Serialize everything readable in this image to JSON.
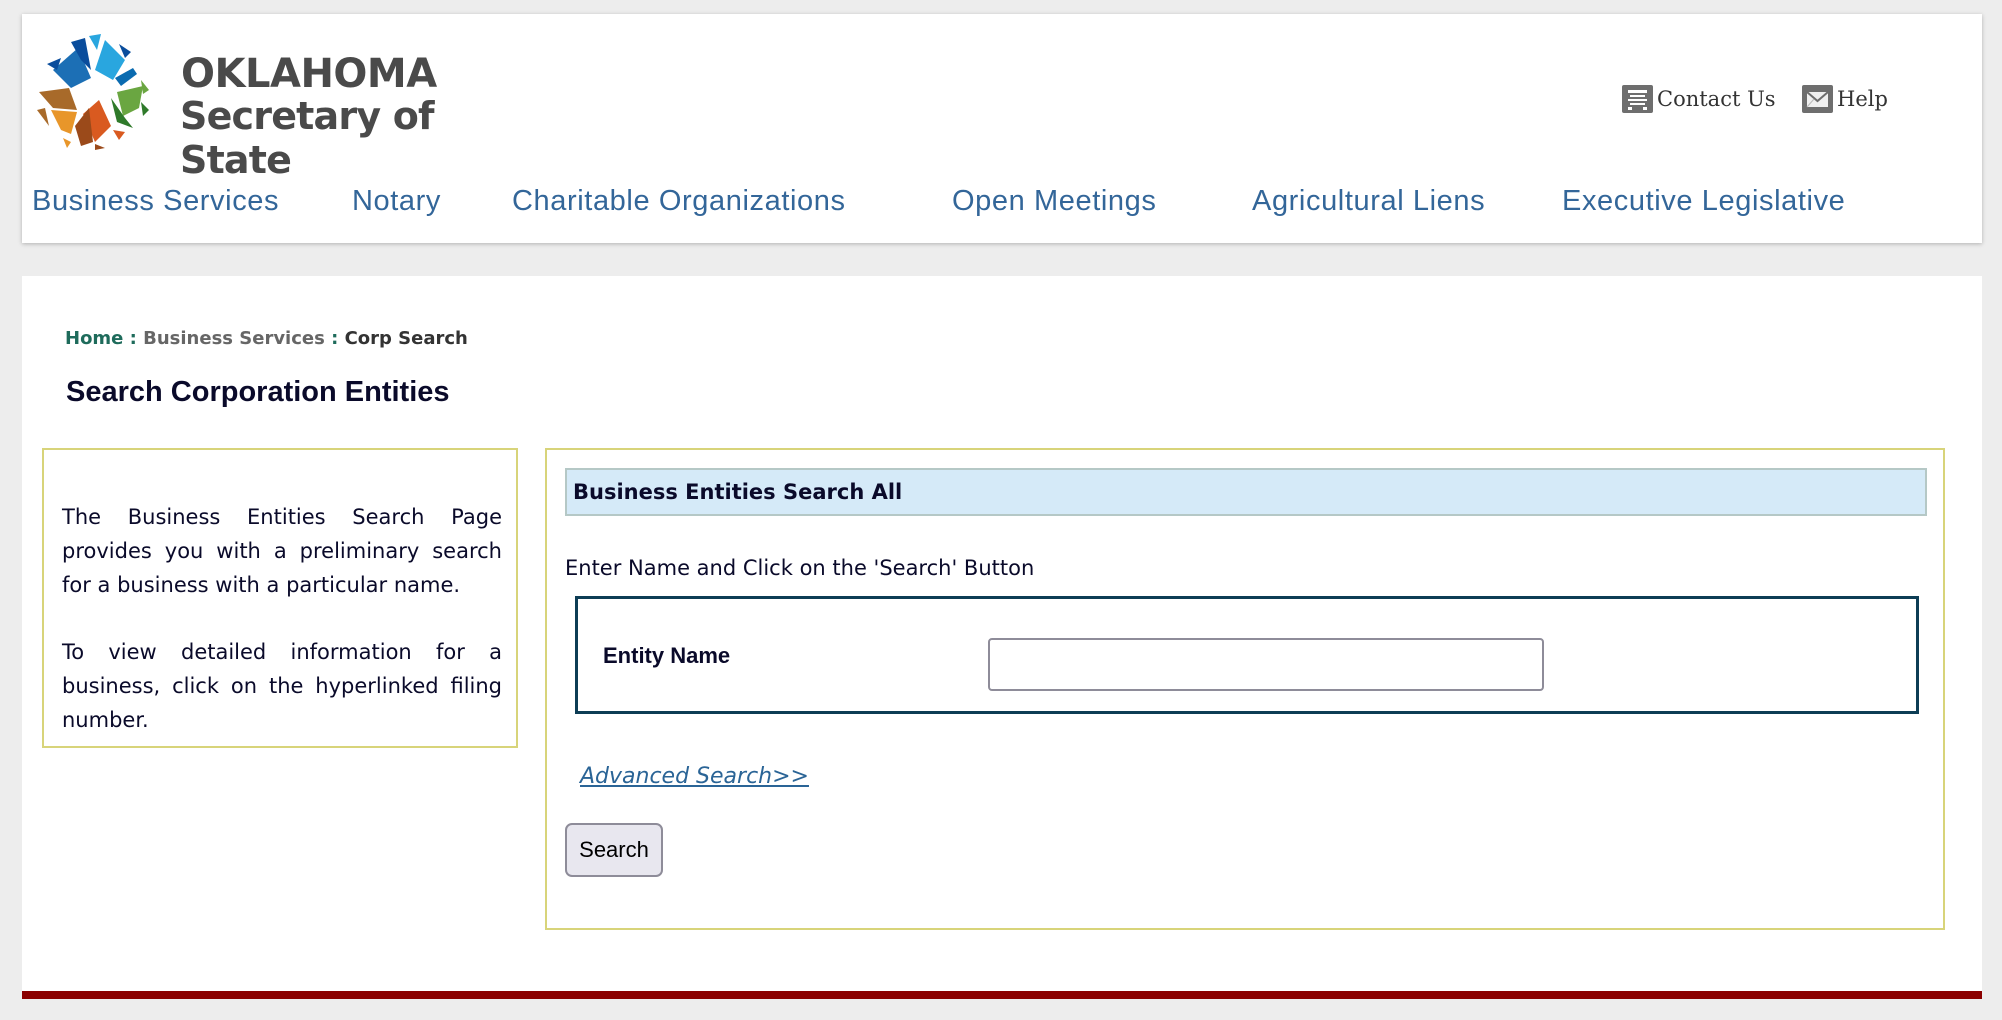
{
  "header": {
    "logo": {
      "line1": "OKLAHOMA",
      "line2": "Secretary of State",
      "icon": "oklahoma-star-logo",
      "colors": [
        "#1c6fb5",
        "#29a6df",
        "#0a4d9c",
        "#6aa641",
        "#2f7a2a",
        "#d95a20",
        "#9b4a1a",
        "#e8962a",
        "#a86a2a"
      ]
    },
    "utility_links": [
      {
        "label": "Contact Us",
        "icon": "contact-form-icon"
      },
      {
        "label": "Help",
        "icon": "envelope-icon"
      }
    ],
    "nav": [
      {
        "label": "Business Services"
      },
      {
        "label": "Notary"
      },
      {
        "label": "Charitable Organizations"
      },
      {
        "label": "Open Meetings"
      },
      {
        "label": "Agricultural Liens"
      },
      {
        "label": "Executive Legislative"
      }
    ]
  },
  "breadcrumb": {
    "home": "Home",
    "separator": " : ",
    "section": "Business Services",
    "current": "Corp Search"
  },
  "page_title": "Search Corporation Entities",
  "info": {
    "paragraph1": "The Business Entities Search Page provides you with a preliminary search for a business with a particular name.",
    "paragraph2": "To view detailed information for a business, click on the hyperlinked filing number."
  },
  "search": {
    "header": "Business Entities Search All",
    "instruction": "Enter Name and Click on the 'Search' Button",
    "entity_name_label": "Entity Name",
    "entity_name_value": "",
    "entity_name_placeholder": "",
    "advanced_link": "Advanced Search>>",
    "search_button": "Search"
  },
  "colors": {
    "nav_link": "#336699",
    "breadcrumb_home": "#1e6b5b",
    "box_border": "#d8d47a",
    "section_header_bg": "#d5eaf8",
    "entity_border": "#0d3d55",
    "footer_bar": "#8b0000",
    "link": "#2a6496"
  }
}
